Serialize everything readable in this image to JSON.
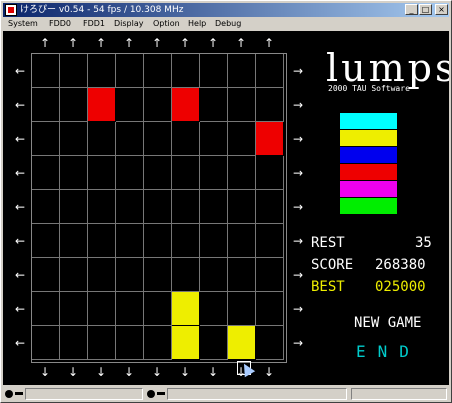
{
  "window": {
    "title": "けろぴー v0.54 - 54 fps / 10.308 MHz"
  },
  "titlebar_buttons": {
    "minimize": "_",
    "maximize": "□",
    "close": "×"
  },
  "menu": [
    "System",
    "FDD0",
    "FDD1",
    "Display",
    "Option",
    "Help",
    "Debug"
  ],
  "game": {
    "logo": "lumps",
    "copyright": "2000  TAU Software",
    "rest_label": "REST",
    "rest_value": "35",
    "score_label": "SCORE",
    "score_value": "268380",
    "best_label": "BEST",
    "best_value": "025000",
    "new_game": "NEW GAME",
    "end": "END",
    "arrow_up": "↑",
    "arrow_down": "↓",
    "arrow_left": "←",
    "arrow_right": "→"
  },
  "palette": [
    "#00ffff",
    "#eeee00",
    "#0000ee",
    "#ee0000",
    "#ee00ee",
    "#00ee00"
  ],
  "blocks": [
    {
      "col": 2,
      "row": 1,
      "color": "#ee0000"
    },
    {
      "col": 5,
      "row": 1,
      "color": "#ee0000"
    },
    {
      "col": 8,
      "row": 2,
      "color": "#ee0000"
    },
    {
      "col": 5,
      "row": 7,
      "color": "#eeee00"
    },
    {
      "col": 5,
      "row": 8,
      "color": "#eeee00"
    },
    {
      "col": 7,
      "row": 8,
      "color": "#eeee00"
    }
  ]
}
